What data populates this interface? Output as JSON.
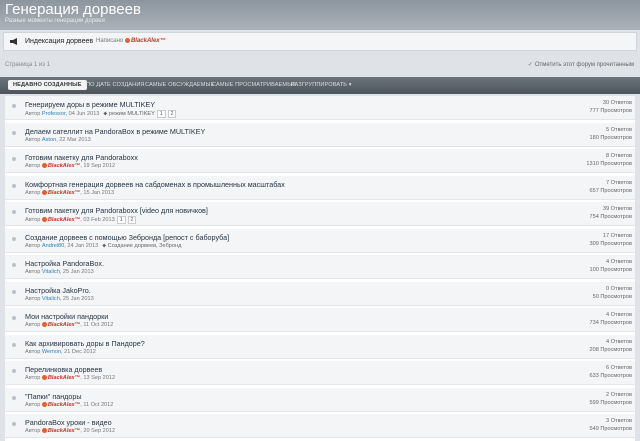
{
  "header": {
    "title": "Генерация дорвеев",
    "subtitle": "Разные моменты генерации дорвея"
  },
  "sticky": {
    "title": "Индексация дорвеев",
    "by_label": "Написано",
    "author": "BlackAlex™"
  },
  "pagination": {
    "text": "Страница 1 из 1",
    "mark_read": "Отметить этот форум прочитанным"
  },
  "tabs": [
    {
      "label": "НЕДАВНО СОЗДАННЫЕ"
    },
    {
      "label": "ПО ДАТЕ СОЗДАНИЯ"
    },
    {
      "label": "САМЫЕ ОБСУЖДАЕМЫЕ"
    },
    {
      "label": "САМЫЕ ПРОСМАТРИВАЕМЫЕ"
    },
    {
      "label": "РАЗГРУППИРОВАТЬ ▾"
    }
  ],
  "author_prefix": "Автор",
  "topics": [
    {
      "title": "Генерируем доры в режиме MULTIKEY",
      "author": "Professor",
      "date": "04 Jun 2013",
      "tags": "режим MULTIKEY",
      "pages": [
        "1",
        "2"
      ],
      "replies": "30 Ответов",
      "views": "777 Просмотров"
    },
    {
      "title": "Делаем сателлит на PandoraBox в режиме MULTIKEY",
      "author": "Aston",
      "date": "22 Mar 2013",
      "tags": "",
      "pages": [],
      "replies": "5 Ответов",
      "views": "180 Просмотров"
    },
    {
      "title": "Готовим пакетку для Pandoraboxx",
      "author": "BlackAlex™",
      "date": "19 Sep 2012",
      "tags": "",
      "pages": [],
      "replies": "8 Ответов",
      "views": "1310 Просмотров"
    },
    {
      "title": "Комфортная генерация дорвеев на сабдоменах в промышленных масштабах",
      "author": "BlackAlex™",
      "date": "15 Jan 2013",
      "tags": "",
      "pages": [],
      "replies": "7 Ответов",
      "views": "657 Просмотров"
    },
    {
      "title": "Готовим пакетку для Pandoraboxx [video для новичков]",
      "author": "BlackAlex™",
      "date": "03 Feb 2013",
      "tags": "",
      "pages": [
        "1",
        "2"
      ],
      "replies": "39 Ответов",
      "views": "754 Просмотров"
    },
    {
      "title": "Создание дорвеев с помощью Зебронда [репост с баборуба]",
      "author": "Andrei80",
      "date": "24 Jan 2013",
      "tags": "Создание дорвеев, Зебронд",
      "pages": [],
      "replies": "17 Ответов",
      "views": "309 Просмотров"
    },
    {
      "title": "Настройка PandoraBox.",
      "author": "Vitalich",
      "date": "25 Jan 2013",
      "tags": "",
      "pages": [],
      "replies": "4 Ответов",
      "views": "100 Просмотров"
    },
    {
      "title": "Настройка JakoPro.",
      "author": "Vitalich",
      "date": "25 Jan 2013",
      "tags": "",
      "pages": [],
      "replies": "0 Ответов",
      "views": "50 Просмотров"
    },
    {
      "title": "Мои настройки пандорки",
      "author": "BlackAlex™",
      "date": "11 Oct 2012",
      "tags": "",
      "pages": [],
      "replies": "4 Ответов",
      "views": "734 Просмотров"
    },
    {
      "title": "Как архивировать доры в Пандоре?",
      "author": "Wemon",
      "date": "21 Dec 2012",
      "tags": "",
      "pages": [],
      "replies": "4 Ответов",
      "views": "208 Просмотров"
    },
    {
      "title": "Перелинковка дорвеев",
      "author": "BlackAlex™",
      "date": "13 Sep 2012",
      "tags": "",
      "pages": [],
      "replies": "6 Ответов",
      "views": "633 Просмотров"
    },
    {
      "title": "\"Папки\" пандоры",
      "author": "BlackAlex™",
      "date": "11 Oct 2012",
      "tags": "",
      "pages": [],
      "replies": "2 Ответов",
      "views": "599 Просмотров"
    },
    {
      "title": "PandoraBox уроки - видео",
      "author": "BlackAlex™",
      "date": "20 Sep 2012",
      "tags": "",
      "pages": [],
      "replies": "3 Ответов",
      "views": "549 Просмотров"
    }
  ]
}
